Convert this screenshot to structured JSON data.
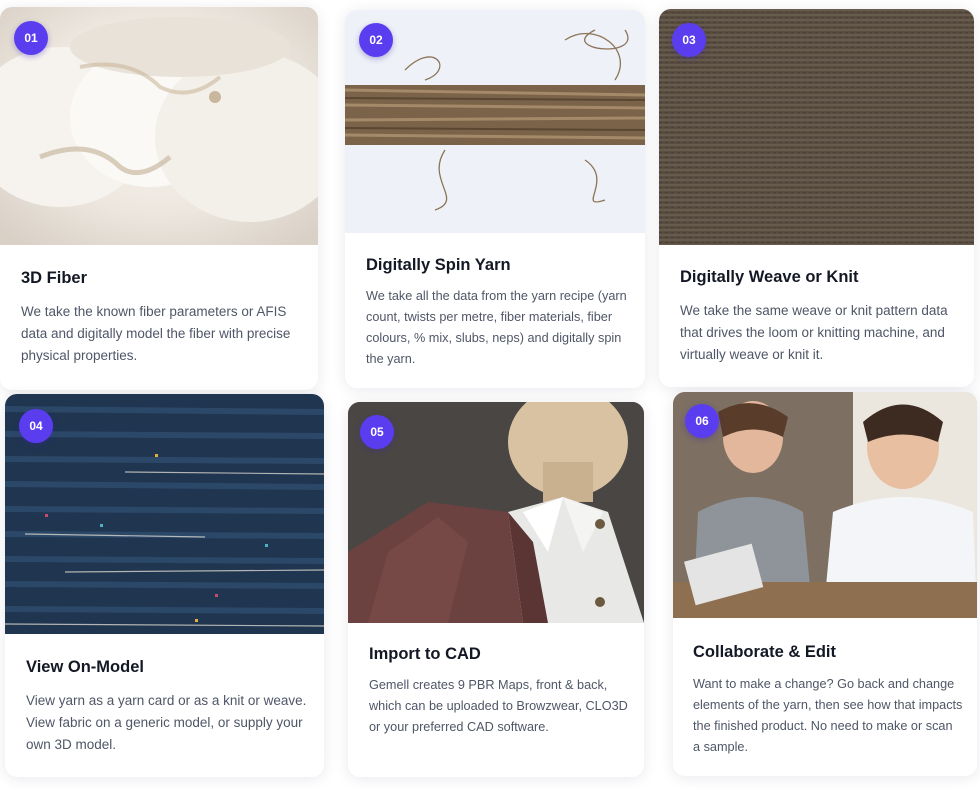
{
  "accent_color": "#5b3df0",
  "cards": [
    {
      "number": "01",
      "title": "3D Fiber",
      "description": "We take the known fiber parameters or AFIS data and digitally model the fiber with precise physical properties.",
      "image": "raw-cotton-fiber-photo"
    },
    {
      "number": "02",
      "title": "Digitally Spin Yarn",
      "description": "We take all the data from the yarn recipe (yarn count, twists per metre, fiber materials, fiber colours, % mix, slubs, neps) and digitally spin the yarn.",
      "image": "spun-yarn-strand-photo"
    },
    {
      "number": "03",
      "title": "Digitally Weave or Knit",
      "description": "We take the same weave or knit pattern data that drives the loom or knitting machine, and virtually weave or knit it.",
      "image": "woven-fabric-texture-photo"
    },
    {
      "number": "04",
      "title": "View On-Model",
      "description": "View yarn as a yarn card or as a knit or weave. View fabric on a generic model, or supply your own 3D model.",
      "image": "denim-knit-texture-photo"
    },
    {
      "number": "05",
      "title": "Import to CAD",
      "description": "Gemell creates 9 PBR Maps, front & back, which can be uploaded to Browzwear, CLO3D or your preferred CAD software.",
      "image": "jacket-on-mannequin-render"
    },
    {
      "number": "06",
      "title": "Collaborate & Edit",
      "description": "Want to make a change? Go back and change elements of the yarn, then see how that impacts the finished product. No need to make or scan a sample.",
      "image": "two-people-reviewing-yarn-photo"
    }
  ]
}
